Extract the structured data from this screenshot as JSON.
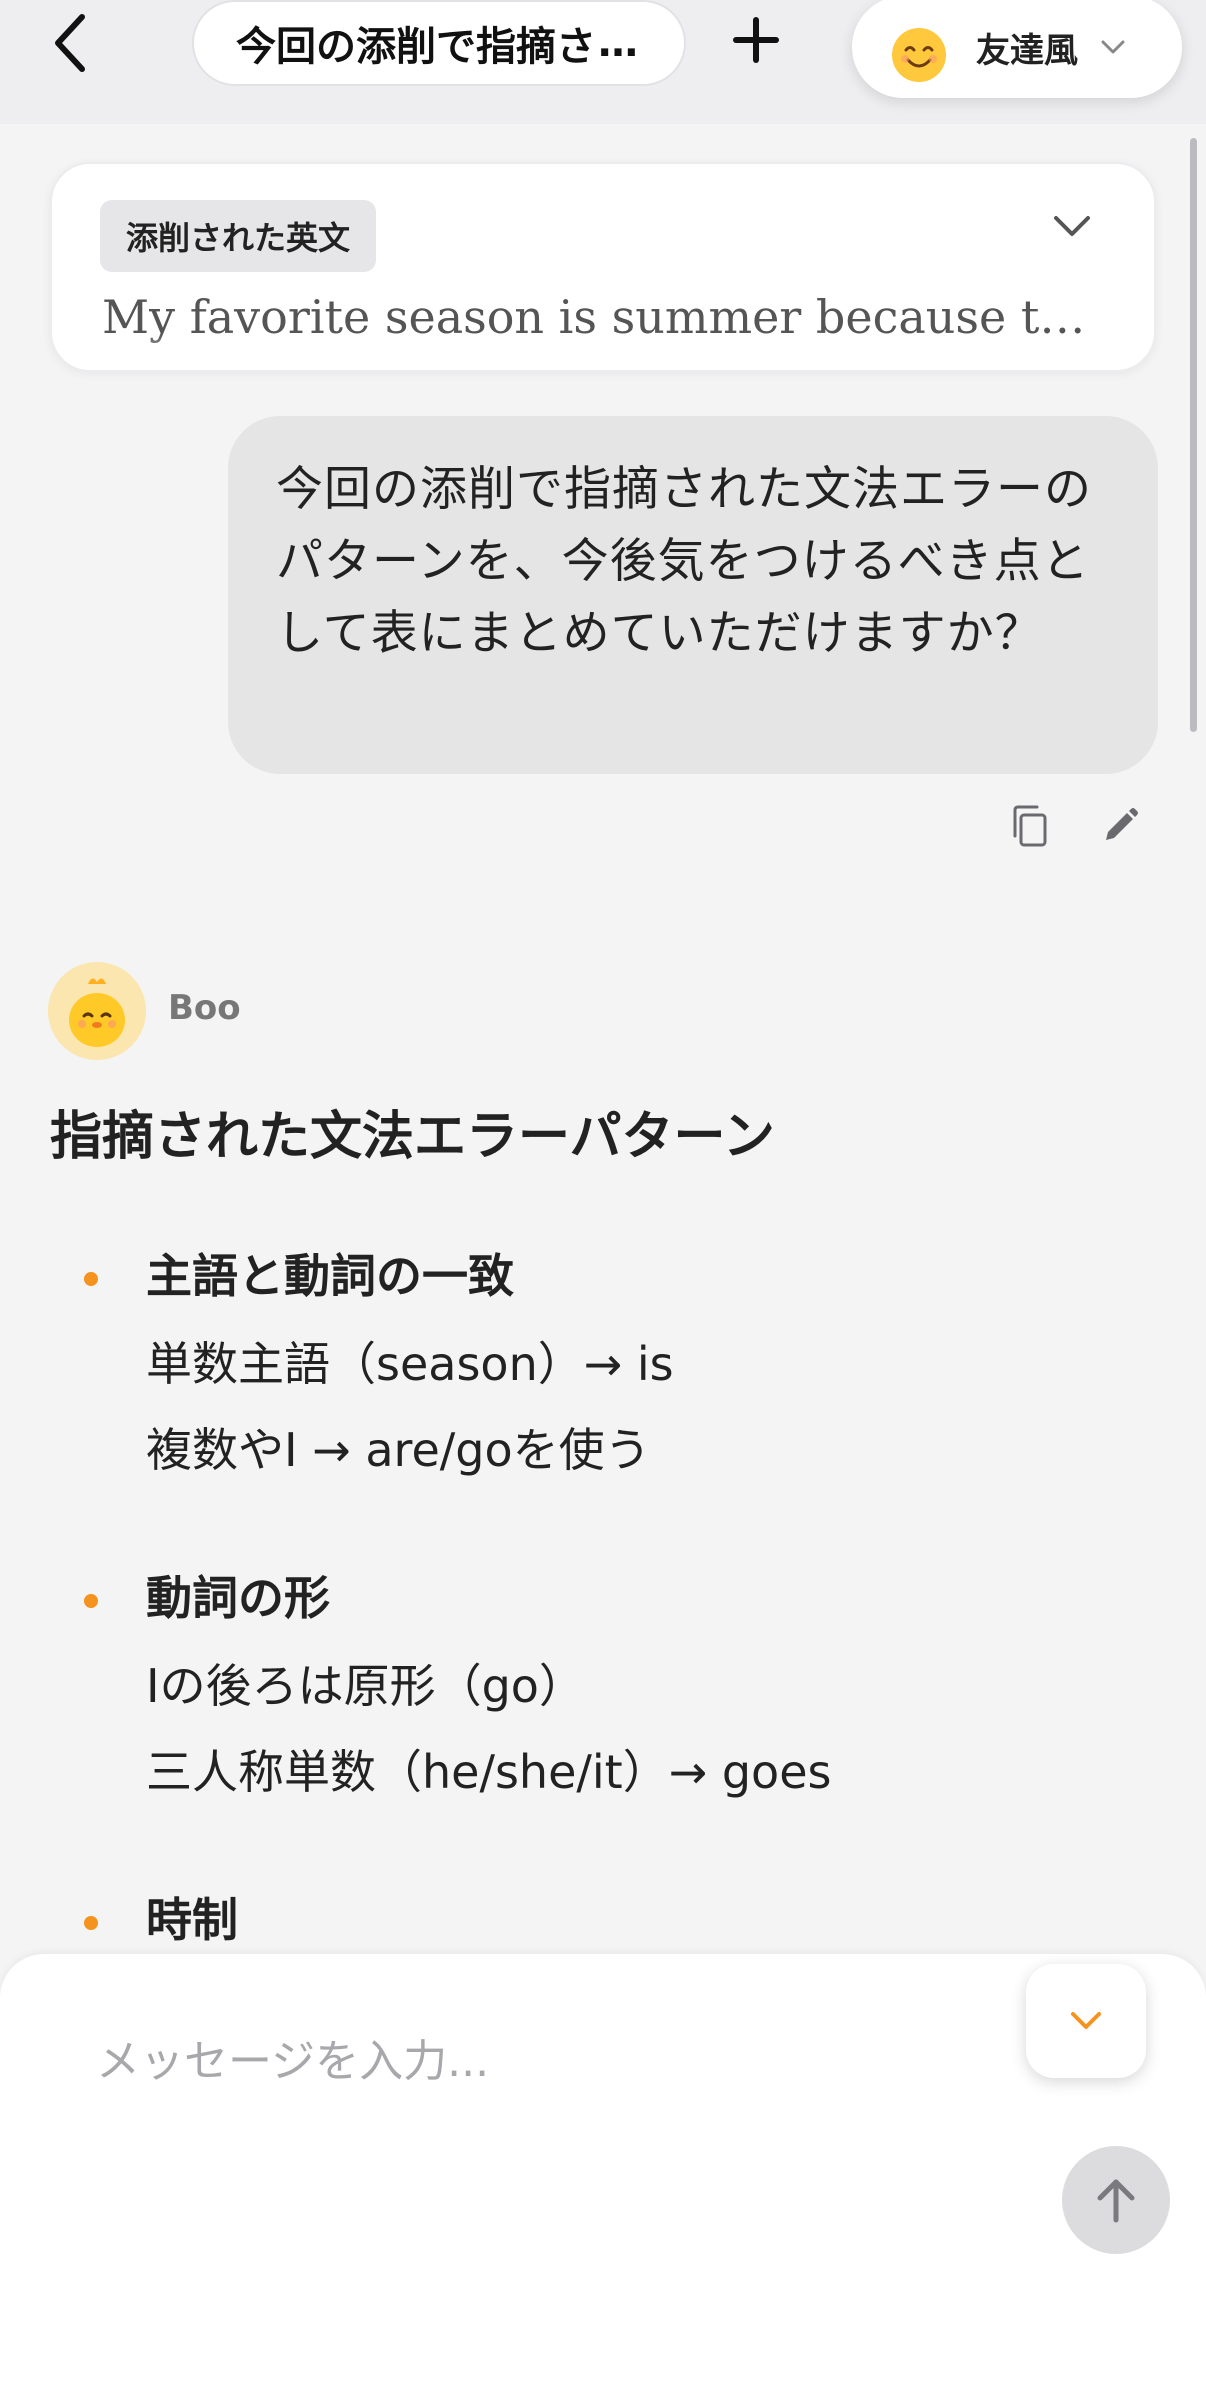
{
  "header": {
    "title": "今回の添削で指摘さ",
    "title_ellipsis": "…",
    "tone_label": "友達風",
    "tone_emoji_icon": "smiling-face-icon"
  },
  "corrected": {
    "tag": "添削された英文",
    "text": "My favorite season is summer because the …"
  },
  "user_message": {
    "text": "今回の添削で指摘された文法エラーのパターンを、今後気をつけるべき点として表にまとめていただけますか？"
  },
  "assistant": {
    "name": "Boo",
    "title": "指摘された文法エラーパターン",
    "sections": [
      {
        "heading": "主語と動詞の一致",
        "lines": [
          "単数主語（season）→ is",
          "複数やI → are/goを使う"
        ]
      },
      {
        "heading": "動詞の形",
        "lines": [
          "Iの後ろは原形（go）",
          "三人称単数（he/she/it）→ goes"
        ]
      },
      {
        "heading": "時制",
        "lines": []
      }
    ]
  },
  "input": {
    "placeholder": "メッセージを入力..."
  },
  "colors": {
    "accent": "#f5931f",
    "background": "#f4f4f5",
    "user_bubble": "#e5e5e6"
  }
}
